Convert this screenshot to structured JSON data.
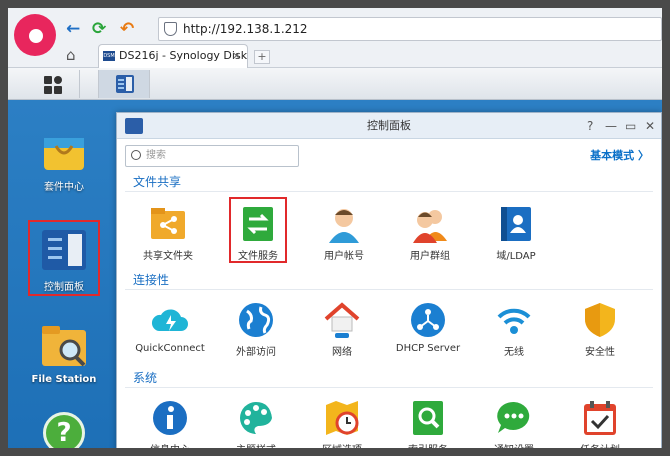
{
  "browser": {
    "url": "http://192.138.1.212",
    "tab_title": "DS216j - Synology Disk",
    "tab_close": "×",
    "new_tab": "+",
    "back_glyph": "←",
    "refresh_glyph": "⟳",
    "undo_glyph": "↶",
    "home_glyph": "⌂"
  },
  "desktop": {
    "icons": [
      {
        "label": "套件中心"
      },
      {
        "label": "控制面板"
      },
      {
        "label": "File Station"
      },
      {
        "label": "?"
      }
    ]
  },
  "window": {
    "title": "控制面板",
    "controls": [
      "?",
      "—",
      "▭",
      "✕"
    ],
    "search_placeholder": "搜索",
    "mode_link": "基本模式 〉"
  },
  "sections": [
    {
      "title": "文件共享",
      "items": [
        {
          "label": "共享文件夹",
          "icon": "share-folder-icon"
        },
        {
          "label": "文件服务",
          "icon": "file-service-icon"
        },
        {
          "label": "用户帐号",
          "icon": "user-icon"
        },
        {
          "label": "用户群组",
          "icon": "group-icon"
        },
        {
          "label": "域/LDAP",
          "icon": "ldap-icon"
        }
      ]
    },
    {
      "title": "连接性",
      "items": [
        {
          "label": "QuickConnect",
          "icon": "cloud-icon"
        },
        {
          "label": "外部访问",
          "icon": "globe-icon"
        },
        {
          "label": "网络",
          "icon": "house-network-icon"
        },
        {
          "label": "DHCP Server",
          "icon": "dhcp-icon"
        },
        {
          "label": "无线",
          "icon": "wifi-icon"
        },
        {
          "label": "安全性",
          "icon": "shield-icon"
        }
      ]
    },
    {
      "title": "系统",
      "items": [
        {
          "label": "信息中心",
          "icon": "info-icon"
        },
        {
          "label": "主题样式",
          "icon": "palette-icon"
        },
        {
          "label": "区域选项",
          "icon": "clock-map-icon"
        },
        {
          "label": "索引服务",
          "icon": "search-doc-icon"
        },
        {
          "label": "通知设置",
          "icon": "chat-icon"
        },
        {
          "label": "任务计划",
          "icon": "calendar-icon"
        }
      ]
    }
  ],
  "colors": {
    "accent": "#1a6fc3",
    "highlight": "#e1292b",
    "desktop": "#2c7fc4"
  }
}
